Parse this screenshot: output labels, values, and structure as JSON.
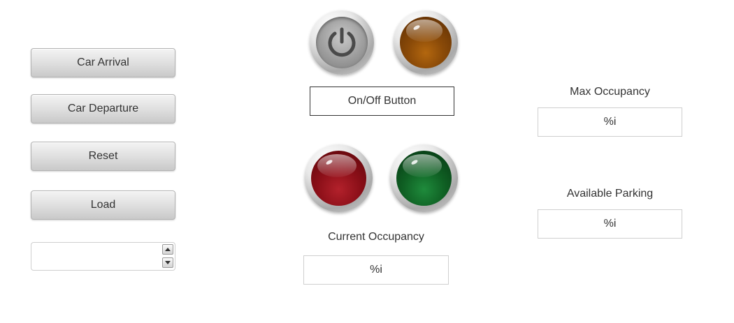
{
  "controls": {
    "car_arrival_label": "Car Arrival",
    "car_departure_label": "Car Departure",
    "reset_label": "Reset",
    "load_label": "Load",
    "spinner_value": ""
  },
  "indicators": {
    "power_button_icon": "power-icon",
    "onoff_label": "On/Off Button",
    "led_colors": {
      "orange": "#8a4a08",
      "red": "#8b0f18",
      "green": "#0f5f23"
    }
  },
  "occupancy": {
    "current_label": "Current Occupancy",
    "current_value": "%i",
    "max_label": "Max Occupancy",
    "max_value": "%i",
    "available_label": "Available Parking",
    "available_value": "%i"
  }
}
